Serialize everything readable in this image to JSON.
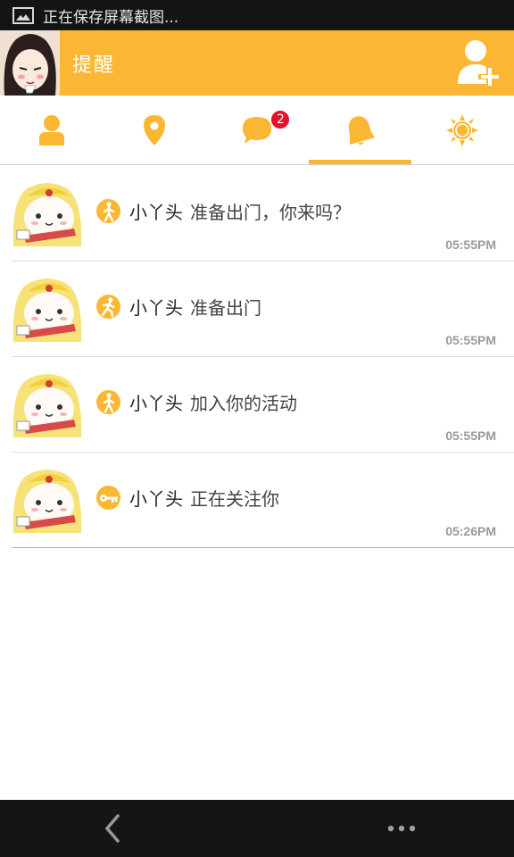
{
  "status_bar": {
    "text": "正在保存屏幕截图..."
  },
  "app_bar": {
    "title": "提醒"
  },
  "tabs": [
    {
      "icon": "person-icon"
    },
    {
      "icon": "location-pin-icon"
    },
    {
      "icon": "chat-bubble-icon",
      "badge": "2"
    },
    {
      "icon": "bell-icon",
      "active": true
    },
    {
      "icon": "sun-icon"
    }
  ],
  "notifications": [
    {
      "user": "小丫头",
      "message": "准备出门，你来吗？",
      "time": "05:55PM",
      "icon": "walking-person-icon"
    },
    {
      "user": "小丫头",
      "message": "准备出门",
      "time": "05:55PM",
      "icon": "running-person-icon"
    },
    {
      "user": "小丫头",
      "message": "加入你的活动",
      "time": "05:55PM",
      "icon": "walking-person-icon"
    },
    {
      "user": "小丫头",
      "message": "正在关注你",
      "time": "05:26PM",
      "icon": "key-icon"
    }
  ],
  "colors": {
    "accent": "#fbb733",
    "badge": "#e3122a"
  }
}
